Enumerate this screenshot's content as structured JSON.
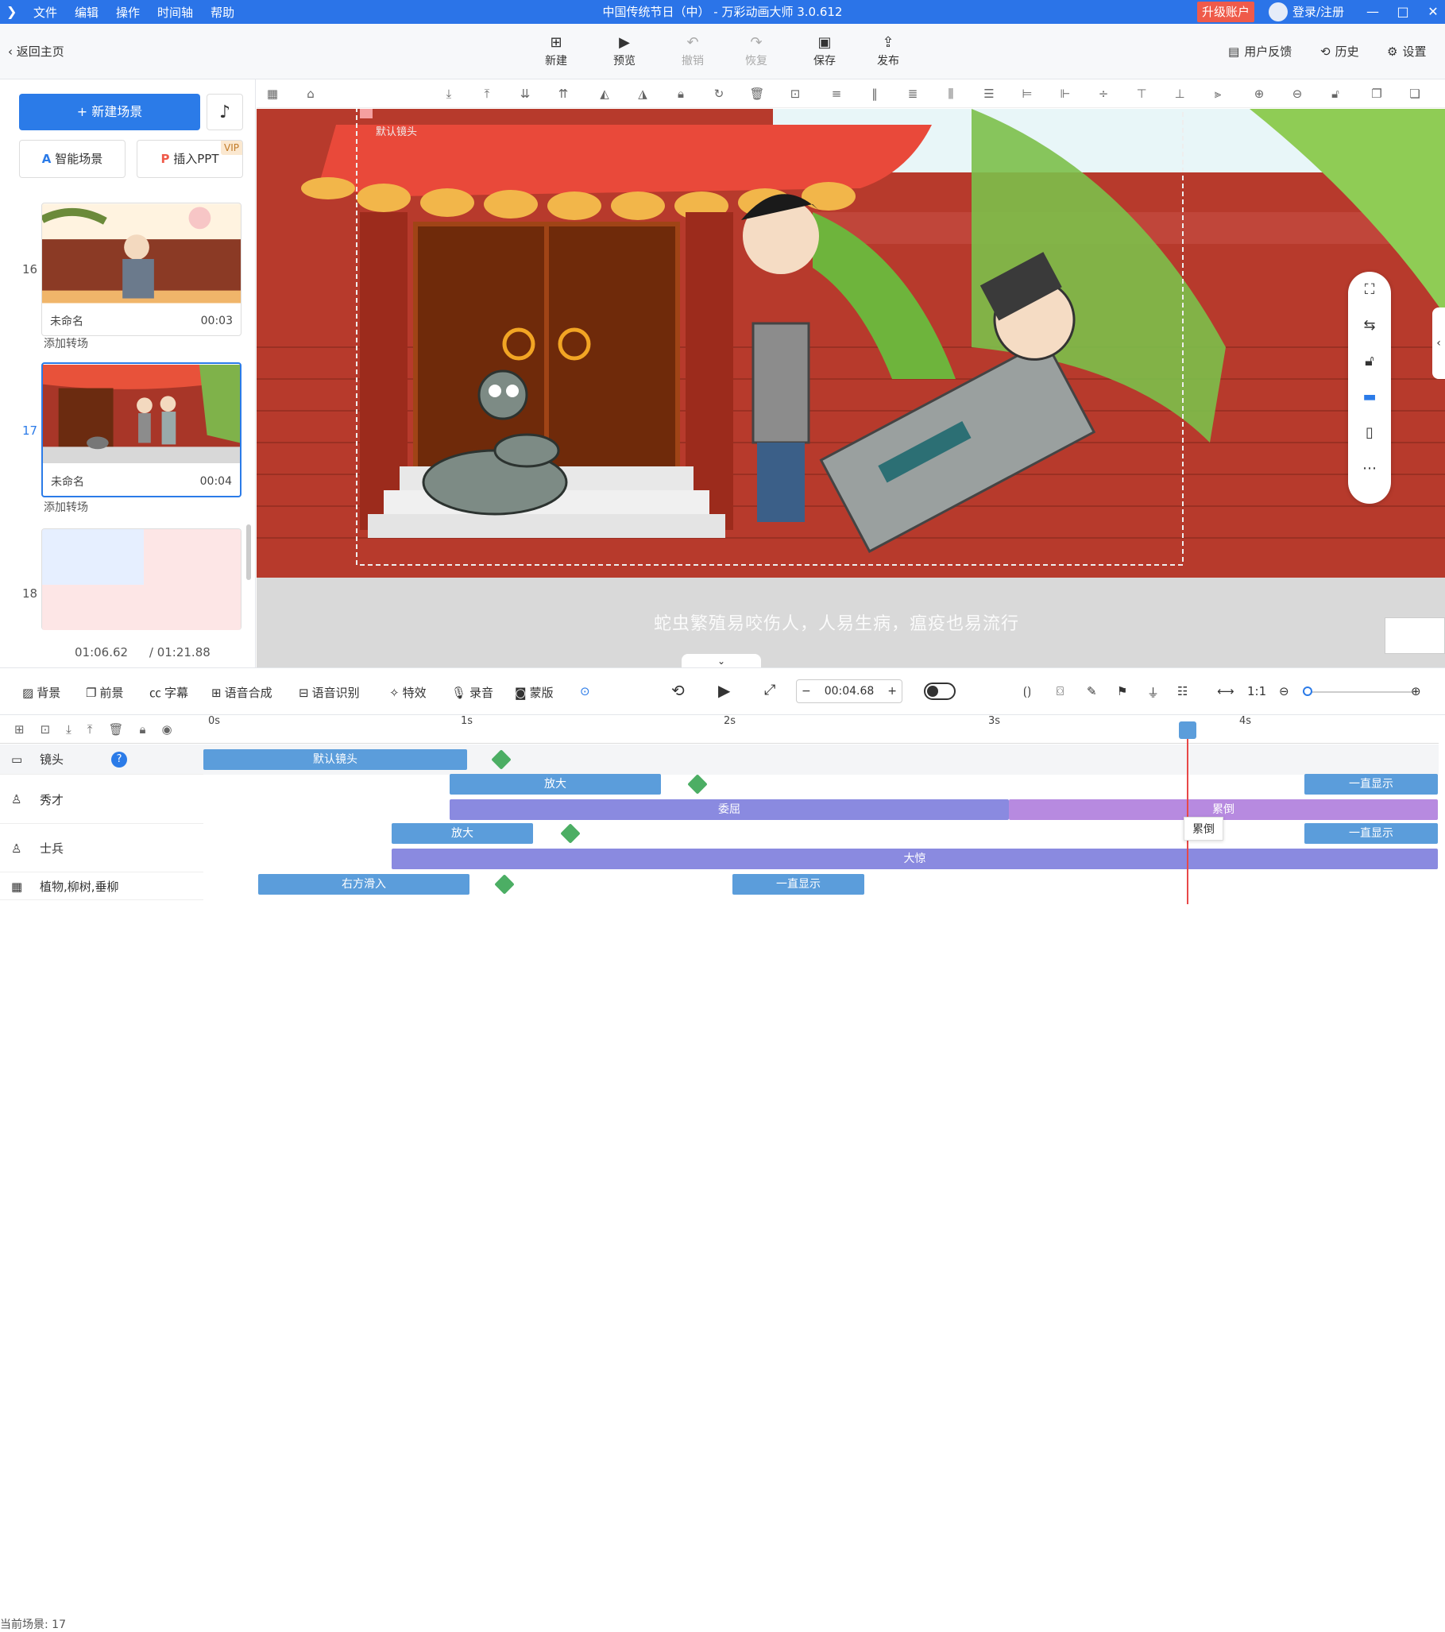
{
  "titlebar": {
    "menu": [
      "文件",
      "编辑",
      "操作",
      "时间轴",
      "帮助"
    ],
    "title": "中国传统节日（中） - 万彩动画大师 3.0.612",
    "upgrade": "升级账户",
    "login": "登录/注册",
    "minimize": "—",
    "maximize": "□",
    "close": "✕"
  },
  "toolbar": {
    "back": "返回主页",
    "new": "新建",
    "preview": "预览",
    "undo": "撤销",
    "redo": "恢复",
    "save": "保存",
    "publish": "发布",
    "feedback": "用户反馈",
    "history": "历史",
    "settings": "设置"
  },
  "left": {
    "new_scene": "+ 新建场景",
    "smart_scene": "智能场景",
    "insert_ppt": "插入PPT",
    "vip": "VIP",
    "scenes": [
      {
        "num": "16",
        "name": "未命名",
        "duration": "00:03"
      },
      {
        "num": "17",
        "name": "未命名",
        "duration": "00:04"
      },
      {
        "num": "18",
        "name": "",
        "duration": ""
      }
    ],
    "add_transition": "添加转场",
    "current_time": "01:06.62",
    "total_time": "/ 01:21.88"
  },
  "canvas": {
    "camera_label": "默认镜头",
    "subtitle": "蛇虫繁殖易咬伤人，人易生病，瘟疫也易流行"
  },
  "bottom": {
    "tools": [
      "背景",
      "前景",
      "字幕",
      "语音合成",
      "语音识别",
      "特效",
      "录音",
      "蒙版"
    ],
    "time": "00:04.68",
    "minus": "−",
    "plus": "+"
  },
  "timeline": {
    "ticks": [
      "0s",
      "1s",
      "2s",
      "3s",
      "4s"
    ],
    "tracks": [
      {
        "name": "镜头"
      },
      {
        "name": "秀才"
      },
      {
        "name": "士兵"
      },
      {
        "name": "植物,柳树,垂柳"
      }
    ],
    "clips": {
      "camera_default": "默认镜头",
      "zoom": "放大",
      "wronged": "委屈",
      "tired": "累倒",
      "always_show": "一直显示",
      "shocked": "大惊",
      "slide_right": "右方滑入"
    },
    "tooltip": "累倒",
    "status": "当前场景: 17"
  }
}
